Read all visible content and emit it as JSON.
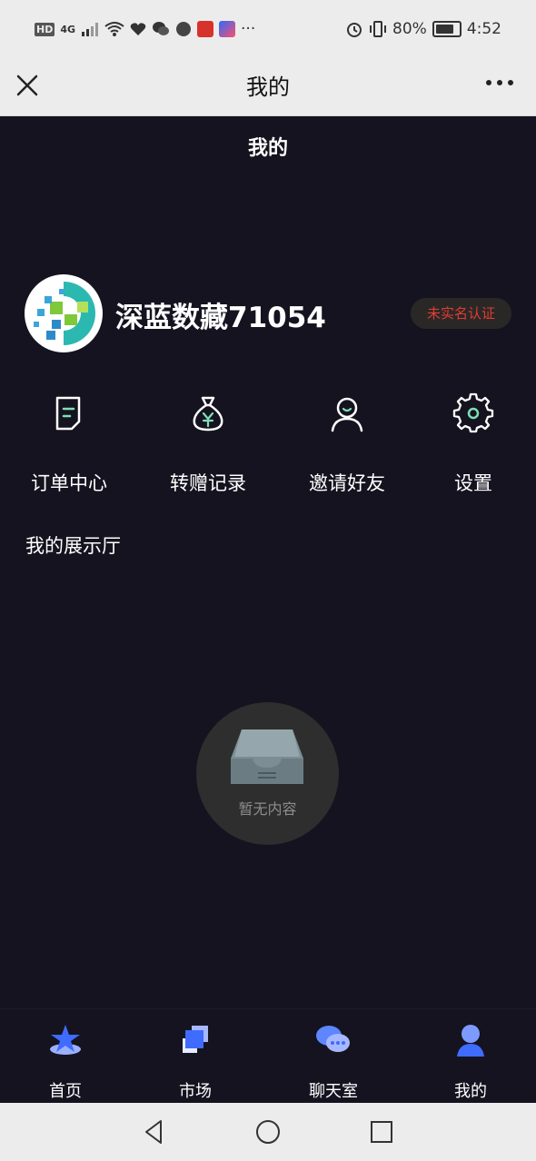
{
  "status_bar": {
    "network_label": "HD",
    "signal_label": "4G",
    "more_indicator": "···",
    "battery_percent": "80%",
    "battery_level": 0.8,
    "time": "4:52"
  },
  "titlebar": {
    "title": "我的",
    "close_icon": "close-icon",
    "more_icon": "more-icon"
  },
  "page": {
    "title": "我的",
    "profile": {
      "username": "深蓝数藏71054",
      "verify_badge": "未实名认证"
    },
    "menu": [
      {
        "label": "订单中心",
        "icon": "order-icon"
      },
      {
        "label": "转赠记录",
        "icon": "money-bag-icon"
      },
      {
        "label": "邀请好友",
        "icon": "user-invite-icon"
      },
      {
        "label": "设置",
        "icon": "gear-icon"
      }
    ],
    "section_title": "我的展示厅",
    "empty_text": "暂无内容"
  },
  "bottom_nav": [
    {
      "label": "首页",
      "icon": "home-star-icon"
    },
    {
      "label": "市场",
      "icon": "market-icon"
    },
    {
      "label": "聊天室",
      "icon": "chat-icon"
    },
    {
      "label": "我的",
      "icon": "profile-icon"
    }
  ],
  "colors": {
    "background": "#15131f",
    "accent_green": "#7de0b5",
    "accent_blue": "#4a7dff",
    "badge_text": "#e23b33"
  }
}
